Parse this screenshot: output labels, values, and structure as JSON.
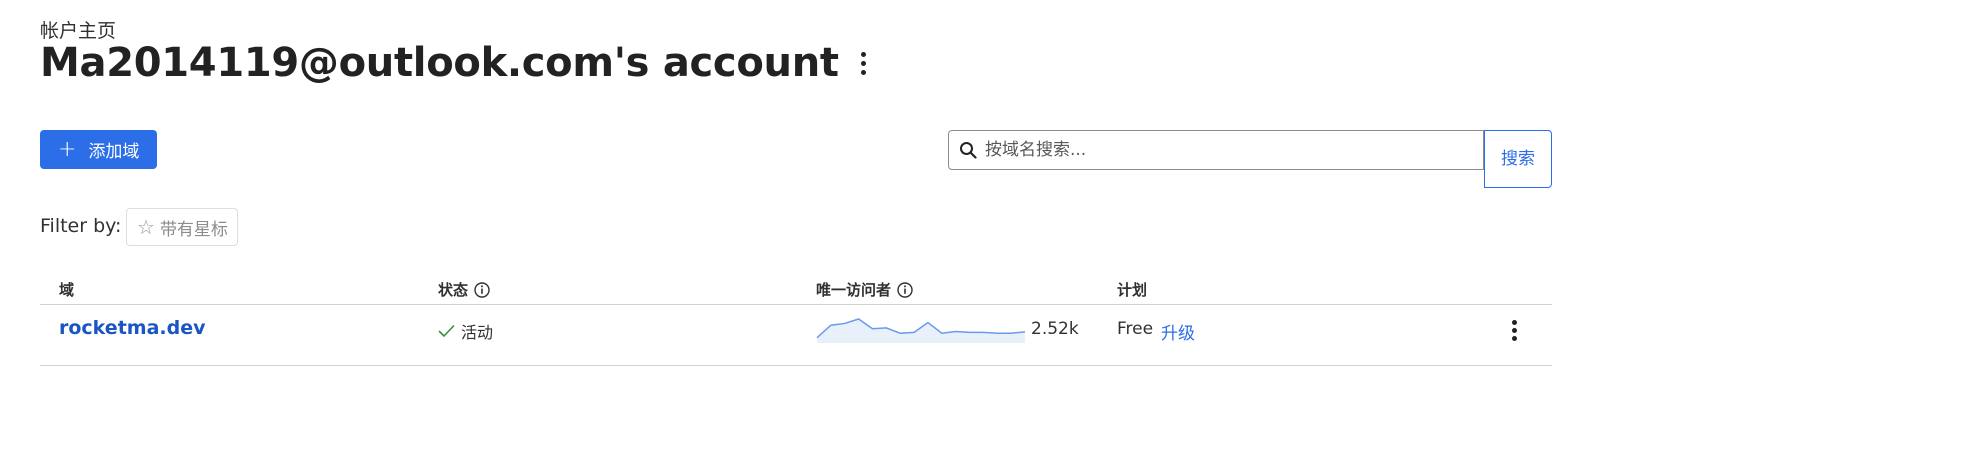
{
  "breadcrumb": "帐户主页",
  "page_title": "Ma2014119@outlook.com's account",
  "actions": {
    "add_domain": "添加域"
  },
  "search": {
    "placeholder": "按域名搜索...",
    "button_label": "搜索"
  },
  "filter": {
    "label": "Filter by:",
    "starred": "带有星标"
  },
  "table": {
    "headers": {
      "domain": "域",
      "status": "状态",
      "visitors": "唯一访问者",
      "plan": "计划"
    },
    "rows": [
      {
        "domain": "rocketma.dev",
        "status": "活动",
        "visitors": "2.52k",
        "visitors_trend": [
          12,
          40,
          44,
          54,
          32,
          34,
          22,
          24,
          46,
          22,
          26,
          24,
          24,
          22,
          22,
          25
        ],
        "plan": "Free",
        "upgrade": "升级"
      }
    ]
  },
  "colors": {
    "accent": "#2b6ee8",
    "link": "#1a55c5",
    "status_ok": "#3c8f3c",
    "sparkline": "#6a9be8",
    "sparkline_fill": "#e8f0fc"
  },
  "icons": {
    "add": "plus-icon",
    "search": "magnifier-icon",
    "star": "star-outline-icon",
    "info": "info-circle-icon",
    "status": "checkmark-icon",
    "more": "vertical-ellipsis-icon"
  }
}
